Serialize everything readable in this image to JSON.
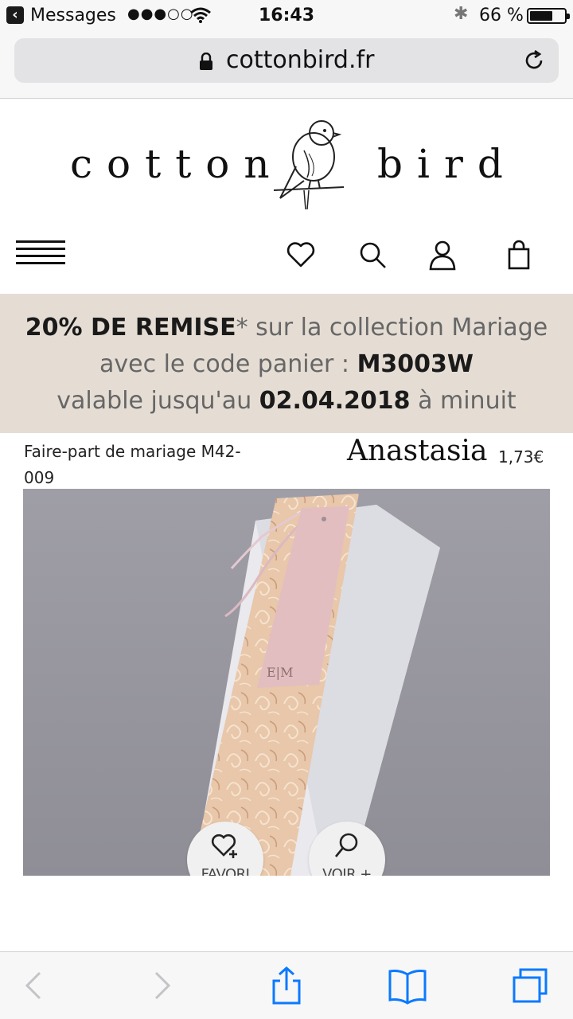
{
  "status_bar": {
    "back_app": "Messages",
    "signal": "●●●○○",
    "time": "16:43",
    "battery": "66 %",
    "battery_level": 0.66
  },
  "browser": {
    "url": "cottonbird.fr"
  },
  "logo": {
    "word_left": "cotton",
    "word_right": "bird"
  },
  "nav": {
    "icons": [
      "menu-icon",
      "heart-icon",
      "search-icon",
      "account-icon",
      "cart-icon"
    ]
  },
  "promo": {
    "discount": "20% DE REMISE",
    "star": "*",
    "line1_rest": " sur la collection Mariage",
    "line2_prefix": "avec le code panier : ",
    "code": "M3003W",
    "line3_prefix": "valable jusqu'au ",
    "date": "02.04.2018",
    "line3_suffix": " à minuit"
  },
  "product": {
    "category": "Faire-part de mariage M42-009",
    "name": "Anastasia",
    "price": "1,73€",
    "tag_text": "E|M",
    "favori_label": "FAVORI",
    "voir_label": "VOIR +"
  },
  "toolbar": {
    "icons": [
      "back-arrow-icon",
      "forward-arrow-icon",
      "share-icon",
      "bookmarks-icon",
      "tabs-icon"
    ],
    "accent": "#0a7aff",
    "disabled": "#c4c4c8"
  }
}
